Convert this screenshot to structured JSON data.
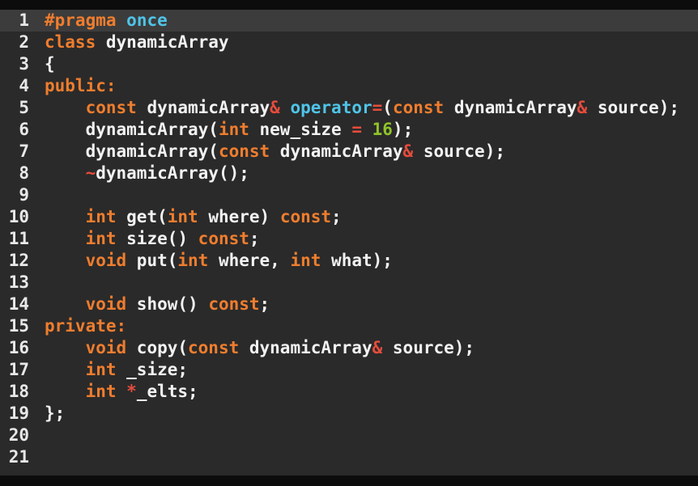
{
  "editor": {
    "palette": {
      "background": "#2a2a2a",
      "bar": "#0c0c0c",
      "line_highlight": "#3c3c3c",
      "plain": "#f2f2f2",
      "line_number": "#e8e8e8",
      "keyword": "#ef7d2e",
      "support": "#4fc4e8",
      "number": "#8fc32a",
      "operator": "#e74c3c"
    },
    "lines": [
      {
        "number": "1",
        "highlighted": true,
        "tokens": [
          {
            "t": "#pragma",
            "c": "keyword"
          },
          {
            "t": " ",
            "c": "plain"
          },
          {
            "t": "once",
            "c": "support"
          }
        ]
      },
      {
        "number": "2",
        "tokens": [
          {
            "t": "class",
            "c": "keyword"
          },
          {
            "t": " dynamicArray",
            "c": "plain"
          }
        ]
      },
      {
        "number": "3",
        "tokens": [
          {
            "t": "{",
            "c": "plain"
          }
        ]
      },
      {
        "number": "4",
        "tokens": [
          {
            "t": "public:",
            "c": "keyword"
          }
        ]
      },
      {
        "number": "5",
        "tokens": [
          {
            "t": "    ",
            "c": "plain"
          },
          {
            "t": "const",
            "c": "keyword"
          },
          {
            "t": " dynamicArray",
            "c": "plain"
          },
          {
            "t": "&",
            "c": "operator"
          },
          {
            "t": " ",
            "c": "plain"
          },
          {
            "t": "operator",
            "c": "support"
          },
          {
            "t": "=",
            "c": "operator"
          },
          {
            "t": "(",
            "c": "plain"
          },
          {
            "t": "const",
            "c": "keyword"
          },
          {
            "t": " dynamicArray",
            "c": "plain"
          },
          {
            "t": "&",
            "c": "operator"
          },
          {
            "t": " source);",
            "c": "plain"
          }
        ]
      },
      {
        "number": "6",
        "tokens": [
          {
            "t": "    dynamicArray(",
            "c": "plain"
          },
          {
            "t": "int",
            "c": "keyword"
          },
          {
            "t": " new_size ",
            "c": "plain"
          },
          {
            "t": "=",
            "c": "operator"
          },
          {
            "t": " ",
            "c": "plain"
          },
          {
            "t": "16",
            "c": "number"
          },
          {
            "t": ");",
            "c": "plain"
          }
        ]
      },
      {
        "number": "7",
        "tokens": [
          {
            "t": "    dynamicArray(",
            "c": "plain"
          },
          {
            "t": "const",
            "c": "keyword"
          },
          {
            "t": " dynamicArray",
            "c": "plain"
          },
          {
            "t": "&",
            "c": "operator"
          },
          {
            "t": " source);",
            "c": "plain"
          }
        ]
      },
      {
        "number": "8",
        "tokens": [
          {
            "t": "    ",
            "c": "plain"
          },
          {
            "t": "~",
            "c": "operator"
          },
          {
            "t": "dynamicArray();",
            "c": "plain"
          }
        ]
      },
      {
        "number": "9",
        "tokens": []
      },
      {
        "number": "10",
        "tokens": [
          {
            "t": "    ",
            "c": "plain"
          },
          {
            "t": "int",
            "c": "keyword"
          },
          {
            "t": " get(",
            "c": "plain"
          },
          {
            "t": "int",
            "c": "keyword"
          },
          {
            "t": " where) ",
            "c": "plain"
          },
          {
            "t": "const",
            "c": "keyword"
          },
          {
            "t": ";",
            "c": "plain"
          }
        ]
      },
      {
        "number": "11",
        "tokens": [
          {
            "t": "    ",
            "c": "plain"
          },
          {
            "t": "int",
            "c": "keyword"
          },
          {
            "t": " size() ",
            "c": "plain"
          },
          {
            "t": "const",
            "c": "keyword"
          },
          {
            "t": ";",
            "c": "plain"
          }
        ]
      },
      {
        "number": "12",
        "tokens": [
          {
            "t": "    ",
            "c": "plain"
          },
          {
            "t": "void",
            "c": "keyword"
          },
          {
            "t": " put(",
            "c": "plain"
          },
          {
            "t": "int",
            "c": "keyword"
          },
          {
            "t": " where, ",
            "c": "plain"
          },
          {
            "t": "int",
            "c": "keyword"
          },
          {
            "t": " what);",
            "c": "plain"
          }
        ]
      },
      {
        "number": "13",
        "tokens": []
      },
      {
        "number": "14",
        "tokens": [
          {
            "t": "    ",
            "c": "plain"
          },
          {
            "t": "void",
            "c": "keyword"
          },
          {
            "t": " show() ",
            "c": "plain"
          },
          {
            "t": "const",
            "c": "keyword"
          },
          {
            "t": ";",
            "c": "plain"
          }
        ]
      },
      {
        "number": "15",
        "tokens": [
          {
            "t": "private:",
            "c": "keyword"
          }
        ]
      },
      {
        "number": "16",
        "tokens": [
          {
            "t": "    ",
            "c": "plain"
          },
          {
            "t": "void",
            "c": "keyword"
          },
          {
            "t": " copy(",
            "c": "plain"
          },
          {
            "t": "const",
            "c": "keyword"
          },
          {
            "t": " dynamicArray",
            "c": "plain"
          },
          {
            "t": "&",
            "c": "operator"
          },
          {
            "t": " source);",
            "c": "plain"
          }
        ]
      },
      {
        "number": "17",
        "tokens": [
          {
            "t": "    ",
            "c": "plain"
          },
          {
            "t": "int",
            "c": "keyword"
          },
          {
            "t": " _size;",
            "c": "plain"
          }
        ]
      },
      {
        "number": "18",
        "tokens": [
          {
            "t": "    ",
            "c": "plain"
          },
          {
            "t": "int",
            "c": "keyword"
          },
          {
            "t": " ",
            "c": "plain"
          },
          {
            "t": "*",
            "c": "operator"
          },
          {
            "t": "_elts;",
            "c": "plain"
          }
        ]
      },
      {
        "number": "19",
        "tokens": [
          {
            "t": "};",
            "c": "plain"
          }
        ]
      },
      {
        "number": "20",
        "tokens": []
      },
      {
        "number": "21",
        "tokens": []
      }
    ]
  }
}
